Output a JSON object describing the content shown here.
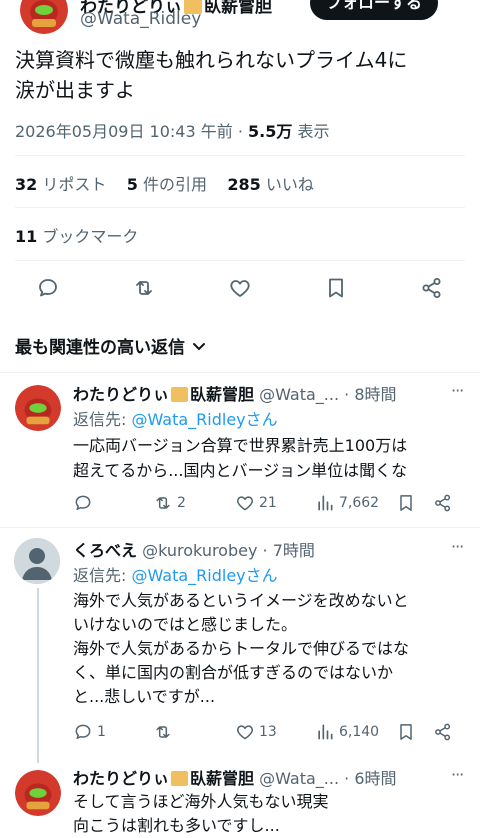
{
  "main_post": {
    "display_name": "わたりどりぃ",
    "display_name_suffix": "臥薪嘗胆",
    "handle": "@Wata_Ridley",
    "follow_label": "フォローする",
    "text_line1": "決算資料で微塵も触れられないプライム4に",
    "text_line2": "涙が出ますよ",
    "timestamp": "2026年05月09日 10:43 午前",
    "dot": "·",
    "views_count": "5.5万",
    "views_label": "表示",
    "reposts_count": "32",
    "reposts_label": "リポスト",
    "quotes_count": "5",
    "quotes_label": "件の引用",
    "likes_count": "285",
    "likes_label": "いいね",
    "bookmarks_count": "11",
    "bookmarks_label": "ブックマーク"
  },
  "sort": {
    "label": "最も関連性の高い返信"
  },
  "replies": [
    {
      "display_name": "わたりどりぃ",
      "display_name_suffix": "臥薪嘗胆",
      "handle": "@Wata_...",
      "time": "· 8時間",
      "reply_prefix": "返信先: ",
      "reply_to": "@Wata_Ridleyさん",
      "text_line1": "一応両バージョン合算で世界累計売上100万は",
      "text_line2": "超えてるから...国内とバージョン単位は聞くな",
      "replies": "",
      "reposts": "2",
      "likes": "21",
      "views": "7,662"
    },
    {
      "display_name": "くろべえ",
      "handle": "@kurokurobey",
      "time": "· 7時間",
      "reply_prefix": "返信先: ",
      "reply_to": "@Wata_Ridleyさん",
      "text_line1": "海外で人気があるというイメージを改めないと",
      "text_line2": "いけないのではと感じました。",
      "text_line3": "海外で人気があるからトータルで伸びるではな",
      "text_line4": "く、単に国内の割合が低すぎるのではないか",
      "text_line5": "と...悲しいですが...",
      "replies": "1",
      "reposts": "",
      "likes": "13",
      "views": "6,140"
    },
    {
      "display_name": "わたりどりぃ",
      "display_name_suffix": "臥薪嘗胆",
      "handle": "@Wata_...",
      "time": "· 6時間",
      "text_line1": "そして言うほど海外人気もない現実",
      "text_line2": "向こうは割れも多いですし..."
    }
  ],
  "colors": {
    "accent": "#1d9bf0",
    "text": "#0f1419",
    "muted": "#536471",
    "divider": "#eff3f4"
  }
}
